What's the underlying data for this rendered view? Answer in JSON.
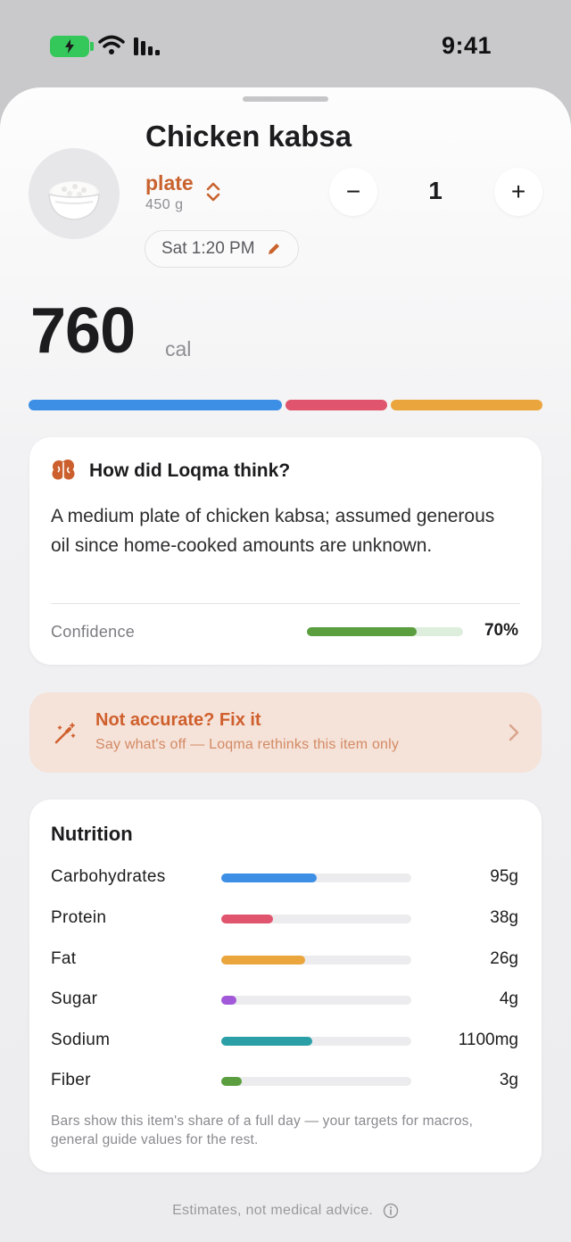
{
  "status_bar": {
    "time": "9:41"
  },
  "item": {
    "name": "Chicken kabsa",
    "serving_unit": "plate",
    "serving_grams": "450 g",
    "quantity": "1",
    "minus_label": "−",
    "plus_label": "+",
    "logged_time": "Sat 1:20 PM"
  },
  "calories": {
    "value": "760",
    "unit": "cal"
  },
  "macro_split": [
    {
      "name": "carbohydrates",
      "color": "#3d8fe6",
      "share": 0.5
    },
    {
      "name": "protein",
      "color": "#e0556d",
      "share": 0.2
    },
    {
      "name": "fat",
      "color": "#eba53d",
      "share": 0.3
    }
  ],
  "reasoning": {
    "title": "How did Loqma think?",
    "text": "A medium plate of chicken kabsa; assumed generous oil since home-cooked amounts are unknown.",
    "confidence_label": "Confidence",
    "confidence_value": "70%",
    "confidence": 0.7
  },
  "fix": {
    "title": "Not accurate? Fix it",
    "subtitle": "Say what's off — Loqma rethinks this item only"
  },
  "nutrition": {
    "title": "Nutrition",
    "rows": [
      {
        "label": "Carbohydrates",
        "value": "95g",
        "fraction": 0.5,
        "color": "#3d8fe6"
      },
      {
        "label": "Protein",
        "value": "38g",
        "fraction": 0.27,
        "color": "#e0556d"
      },
      {
        "label": "Fat",
        "value": "26g",
        "fraction": 0.44,
        "color": "#eba53d"
      },
      {
        "label": "Sugar",
        "value": "4g",
        "fraction": 0.08,
        "color": "#a259d9"
      },
      {
        "label": "Sodium",
        "value": "1100mg",
        "fraction": 0.48,
        "color": "#2aa0a6"
      },
      {
        "label": "Fiber",
        "value": "3g",
        "fraction": 0.11,
        "color": "#5a9e3f"
      }
    ],
    "footnote": "Bars show this item's share of a full day — your targets for macros, general guide values for the rest."
  },
  "disclaimer": "Estimates, not medical advice.",
  "icons": {
    "battery": "battery-charging-icon",
    "wifi": "wifi-icon",
    "signal": "signal-icon",
    "food": "rice-bowl-icon",
    "unit_toggle": "chevron-up-down-icon",
    "edit": "pencil-icon",
    "brain": "brain-icon",
    "wand": "magic-wand-icon",
    "chevron": "chevron-right-icon",
    "info": "info-icon"
  }
}
